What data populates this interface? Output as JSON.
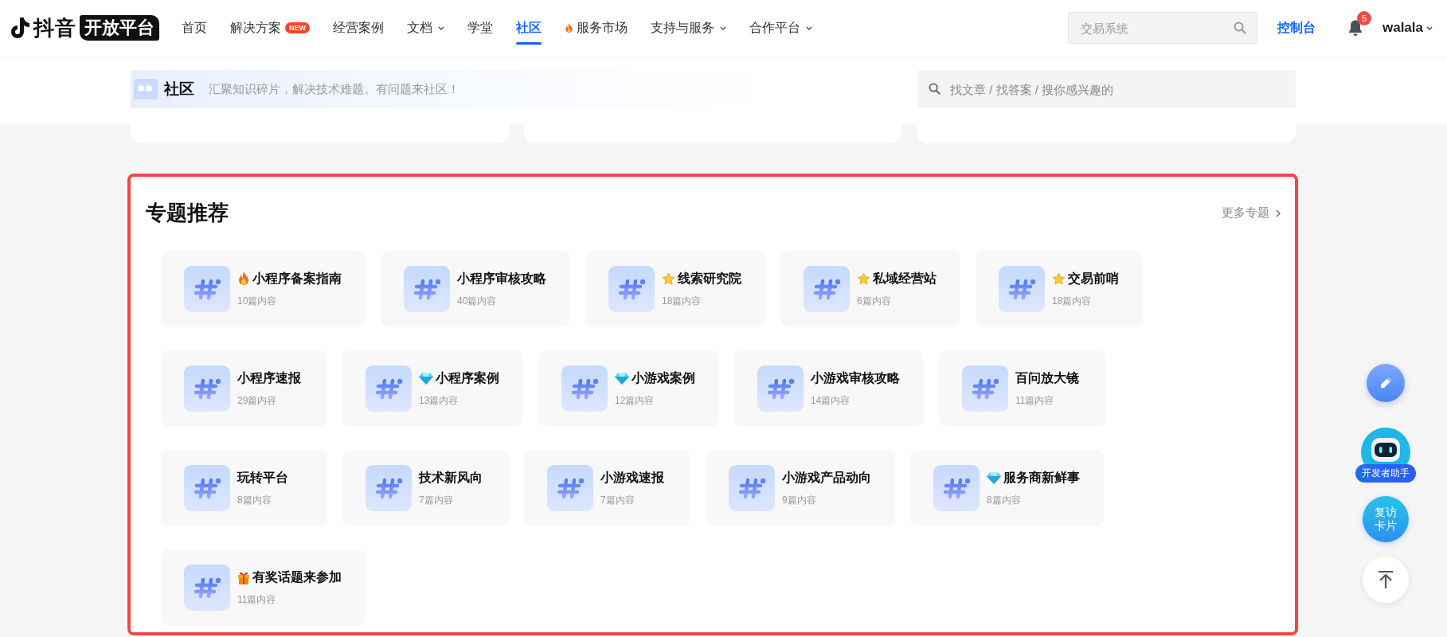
{
  "header": {
    "logo": {
      "brand": "抖音",
      "product": "开放平台"
    },
    "nav": [
      {
        "label": "首页",
        "kind": "link",
        "selected": false
      },
      {
        "label": "解决方案",
        "kind": "badge",
        "badge": "NEW",
        "selected": false
      },
      {
        "label": "经营案例",
        "kind": "link",
        "selected": false
      },
      {
        "label": "文档",
        "kind": "dropdown",
        "selected": false
      },
      {
        "label": "学堂",
        "kind": "link",
        "selected": false
      },
      {
        "label": "社区",
        "kind": "link",
        "selected": true
      },
      {
        "label": "服务市场",
        "kind": "hot",
        "selected": false
      },
      {
        "label": "支持与服务",
        "kind": "dropdown",
        "selected": false
      },
      {
        "label": "合作平台",
        "kind": "dropdown",
        "selected": false
      }
    ],
    "search": {
      "placeholder": "交易系统"
    },
    "console": "控制台",
    "notifications": "5",
    "user": "walala"
  },
  "community": {
    "title": "社区",
    "subtitle": "汇聚知识碎片，解决技术难题。有问题来社区！",
    "search": {
      "placeholder": "找文章 / 找答案 / 搜你感兴趣的"
    }
  },
  "topics": {
    "title": "专题推荐",
    "more": "更多专题",
    "rows": [
      [
        {
          "title": "小程序备案指南",
          "count": "10篇内容",
          "kind": "fire"
        },
        {
          "title": "小程序审核攻略",
          "count": "40篇内容",
          "kind": "plain"
        },
        {
          "title": "线索研究院",
          "count": "18篇内容",
          "kind": "star"
        },
        {
          "title": "私域经营站",
          "count": "6篇内容",
          "kind": "star"
        },
        {
          "title": "交易前哨",
          "count": "18篇内容",
          "kind": "star"
        }
      ],
      [
        {
          "title": "小程序速报",
          "count": "29篇内容",
          "kind": "plain"
        },
        {
          "title": "小程序案例",
          "count": "13篇内容",
          "kind": "diamond"
        },
        {
          "title": "小游戏案例",
          "count": "12篇内容",
          "kind": "diamond"
        },
        {
          "title": "小游戏审核攻略",
          "count": "14篇内容",
          "kind": "plain"
        },
        {
          "title": "百问放大镜",
          "count": "11篇内容",
          "kind": "plain"
        }
      ],
      [
        {
          "title": "玩转平台",
          "count": "8篇内容",
          "kind": "plain"
        },
        {
          "title": "技术新风向",
          "count": "7篇内容",
          "kind": "plain"
        },
        {
          "title": "小游戏速报",
          "count": "7篇内容",
          "kind": "plain"
        },
        {
          "title": "小游戏产品动向",
          "count": "9篇内容",
          "kind": "plain"
        },
        {
          "title": "服务商新鲜事",
          "count": "8篇内容",
          "kind": "diamond"
        }
      ],
      [
        {
          "title": "有奖话题来参加",
          "count": "11篇内容",
          "kind": "gift"
        }
      ]
    ]
  },
  "floating": {
    "assistant": "开发者助手",
    "revisit": "复访卡片"
  }
}
